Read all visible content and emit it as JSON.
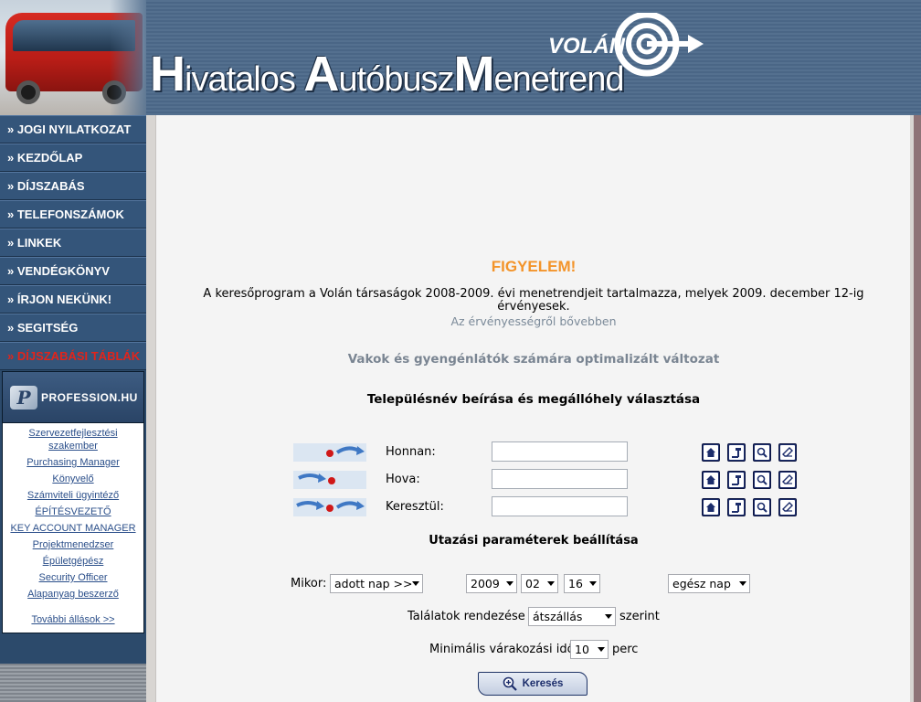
{
  "header": {
    "title_parts": [
      {
        "cap": "H",
        "rest": "ivatalos "
      },
      {
        "cap": "A",
        "rest": "utóbusz"
      },
      {
        "cap": "M",
        "rest": "enetrend"
      }
    ],
    "logo_text": "VOLÁN"
  },
  "sidebar": {
    "items": [
      {
        "label": "» JOGI NYILATKOZAT"
      },
      {
        "label": "» KEZDŐLAP"
      },
      {
        "label": "» DÍJSZABÁS"
      },
      {
        "label": "» TELEFONSZÁMOK"
      },
      {
        "label": "» LINKEK"
      },
      {
        "label": "» VENDÉGKÖNYV"
      },
      {
        "label": "» ÍRJON NEKÜNK!"
      },
      {
        "label": "» SEGITSÉG"
      },
      {
        "label": "» DÍJSZABÁSI TÁBLÁK"
      }
    ],
    "profession": {
      "logo_mark": "P",
      "logo_text": "PROFESSION.HU",
      "jobs": [
        "Szervezetfejlesztési szakember",
        "Purchasing Manager",
        "Könyvelő",
        "Számviteli ügyintéző",
        "ÉPÍTÉSVEZETŐ",
        "KEY ACCOUNT MANAGER",
        "Projektmenedzser",
        "Épületgépész",
        "Security Officer",
        "Alapanyag beszerző"
      ],
      "more": "További állások >>"
    }
  },
  "main": {
    "attention": "FIGYELEM!",
    "notice": "A keresőprogram a Volán társaságok 2008-2009. évi menetrendjeit tartalmazza, melyek 2009. december 12-ig érvényesek.",
    "validity_link": "Az érvényességről bővebben",
    "accessible_link": "Vakok és gyengénlátók számára optimalizált változat",
    "section_stops": "Településnév beírása és megállóhely választása",
    "stops": [
      {
        "label": "Honnan:",
        "value": "",
        "graphic": "from"
      },
      {
        "label": "Hova:",
        "value": "",
        "graphic": "to"
      },
      {
        "label": "Keresztül:",
        "value": "",
        "graphic": "via"
      }
    ],
    "section_params": "Utazási paraméterek beállítása",
    "when_label": "Mikor:",
    "when_value": "adott nap >>",
    "year": "2009",
    "month": "02",
    "day": "16",
    "time_of_day": "egész nap",
    "sort_label": "Találatok rendezése",
    "sort_value": "átszállás",
    "sort_suffix": "szerint",
    "wait_label": "Minimális várakozási idő",
    "wait_value": "10",
    "wait_unit": "perc",
    "search_label": "Keresés"
  },
  "colors": {
    "attention": "#f3942a",
    "nav_bg": "#34557a",
    "nav_highlight": "#e2241b",
    "tool_button": "#1c2d6b"
  }
}
